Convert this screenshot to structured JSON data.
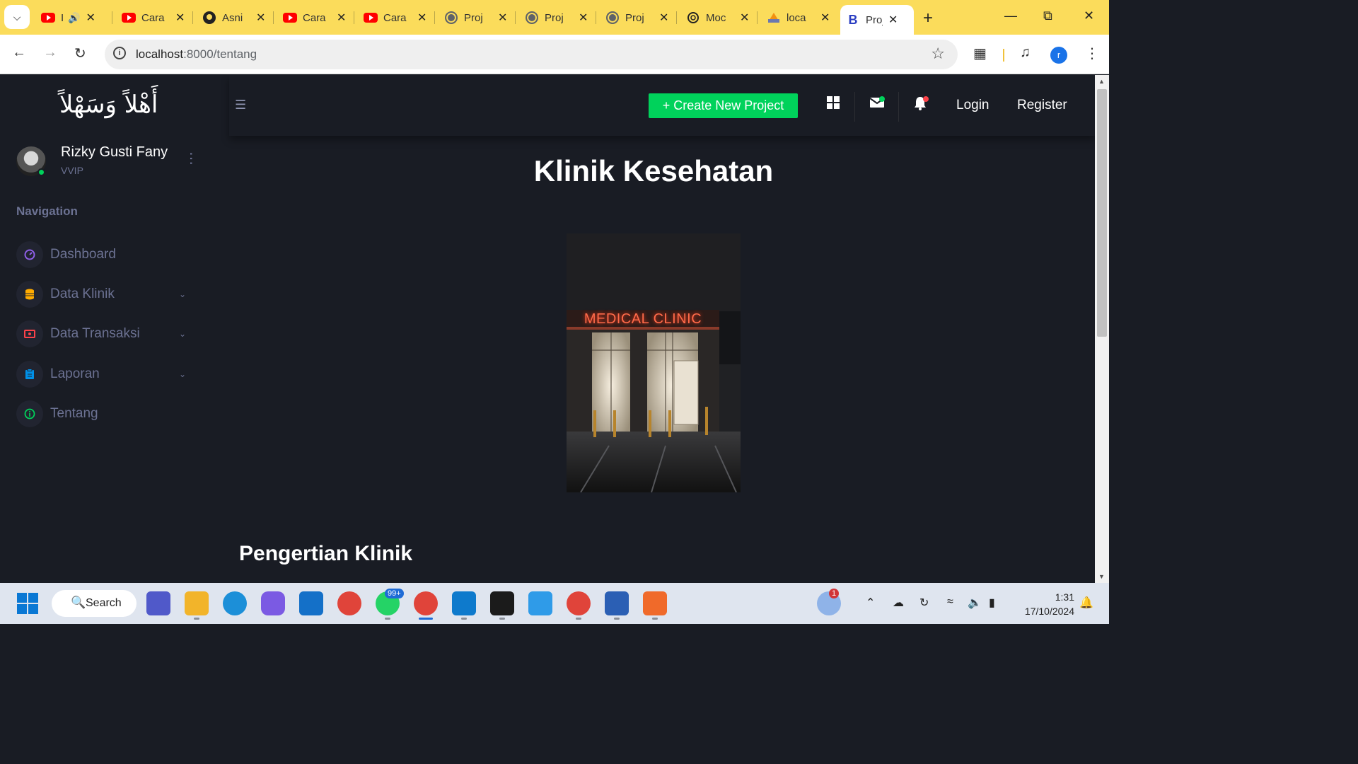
{
  "browser": {
    "tabs": [
      {
        "title": "I",
        "icon": "youtube-icon",
        "audio": true
      },
      {
        "title": "Cara",
        "icon": "youtube-icon"
      },
      {
        "title": "Asni",
        "icon": "github-icon"
      },
      {
        "title": "Cara",
        "icon": "youtube-icon"
      },
      {
        "title": "Cara",
        "icon": "youtube-icon"
      },
      {
        "title": "Proj",
        "icon": "globe-icon"
      },
      {
        "title": "Proj",
        "icon": "globe-icon"
      },
      {
        "title": "Proj",
        "icon": "globe-icon"
      },
      {
        "title": "Moc",
        "icon": "openai-icon"
      },
      {
        "title": "loca",
        "icon": "pma-icon"
      },
      {
        "title": "Proj",
        "icon": "bootstrap-icon",
        "active": true
      }
    ],
    "address": {
      "host": "localhost",
      "path": ":8000/tentang"
    },
    "profile_initial": "r"
  },
  "app": {
    "brand": "أَهْلاً وَسَهْلاً",
    "user": {
      "name": "Rizky Gusti Fany",
      "role": "VVIP"
    },
    "nav_title": "Navigation",
    "nav_items": [
      {
        "label": "Dashboard",
        "icon": "speedometer-icon",
        "color": "#8f5fe8",
        "chevron": false
      },
      {
        "label": "Data Klinik",
        "icon": "database-icon",
        "color": "#ffab00",
        "chevron": true
      },
      {
        "label": "Data Transaksi",
        "icon": "cash-icon",
        "color": "#fc424a",
        "chevron": true
      },
      {
        "label": "Laporan",
        "icon": "clipboard-icon",
        "color": "#0090e7",
        "chevron": true
      },
      {
        "label": "Tentang",
        "icon": "info-icon",
        "color": "#00d25b",
        "chevron": false
      }
    ],
    "create_button": "+ Create New Project",
    "login": "Login",
    "register": "Register",
    "page_title": "Klinik Kesehatan",
    "image_sign": "MEDICAL CLINIC",
    "section_title": "Pengertian Klinik"
  },
  "taskbar": {
    "search": "Search",
    "whatsapp_badge": "99+",
    "weather_badge": "1",
    "time": "1:31",
    "date": "17/10/2024"
  },
  "colors": {
    "tab_strip": "#fbdc5b",
    "app_bg": "#191c24",
    "accent_green": "#00d25b",
    "muted_text": "#6c7293"
  }
}
